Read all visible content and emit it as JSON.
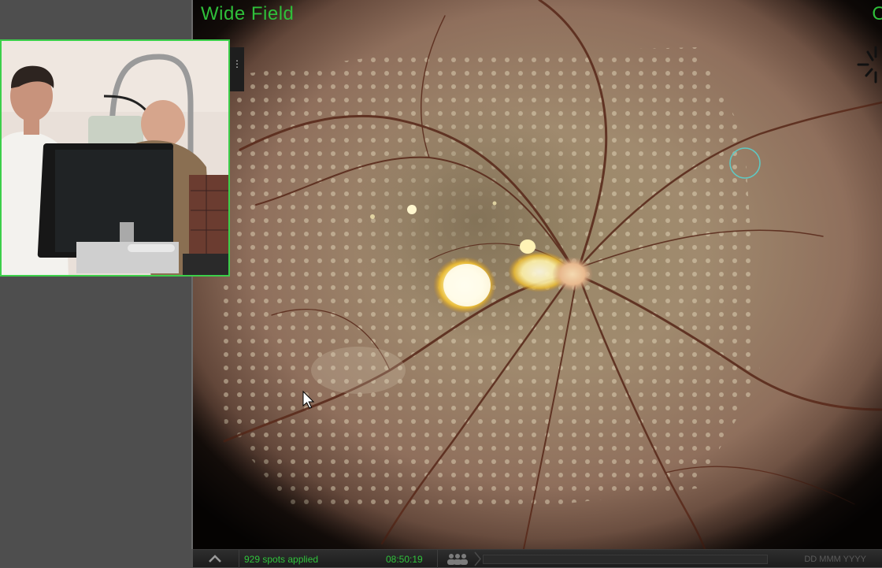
{
  "header": {
    "view_mode": "Wide Field",
    "right_label": "O"
  },
  "webcam": {
    "description_icon": "camera-feed"
  },
  "status_bar": {
    "spots_applied": "929 spots applied",
    "timer": "08:50:19",
    "date_placeholder": "DD MMM YYYY"
  },
  "icons": {
    "expand": "chevron-up-icon",
    "users": "users-icon",
    "busy": "spinner-icon",
    "cursor": "mouse-cursor-icon",
    "aim": "aiming-circle-icon"
  },
  "colors": {
    "accent_green": "#2fbf3a",
    "aim_circle": "#5fc8c2",
    "panel_gray": "#4e4e4e"
  }
}
